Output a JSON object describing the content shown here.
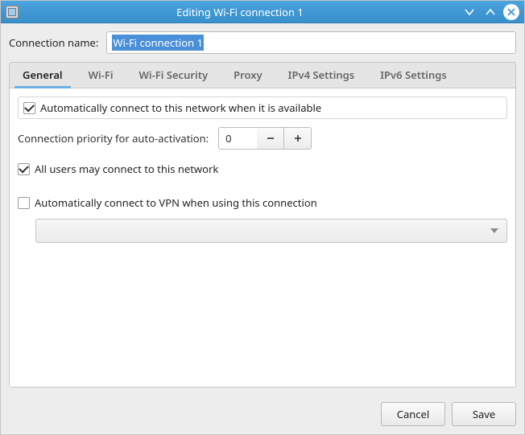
{
  "window": {
    "title": "Editing Wi-Fi connection 1"
  },
  "form": {
    "name_label": "Connection name:",
    "name_value": "Wi-Fi connection 1"
  },
  "tabs": [
    {
      "label": "General"
    },
    {
      "label": "Wi-Fi"
    },
    {
      "label": "Wi-Fi Security"
    },
    {
      "label": "Proxy"
    },
    {
      "label": "IPv4 Settings"
    },
    {
      "label": "IPv6 Settings"
    }
  ],
  "general": {
    "auto_connect": {
      "label": "Automatically connect to this network when it is available",
      "checked": true
    },
    "priority": {
      "label": "Connection priority for auto-activation:",
      "value": "0"
    },
    "all_users": {
      "label": "All users may connect to this network",
      "checked": true
    },
    "auto_vpn": {
      "label": "Automatically connect to VPN when using this connection",
      "checked": false
    },
    "vpn_selected": ""
  },
  "footer": {
    "cancel": "Cancel",
    "save": "Save"
  }
}
